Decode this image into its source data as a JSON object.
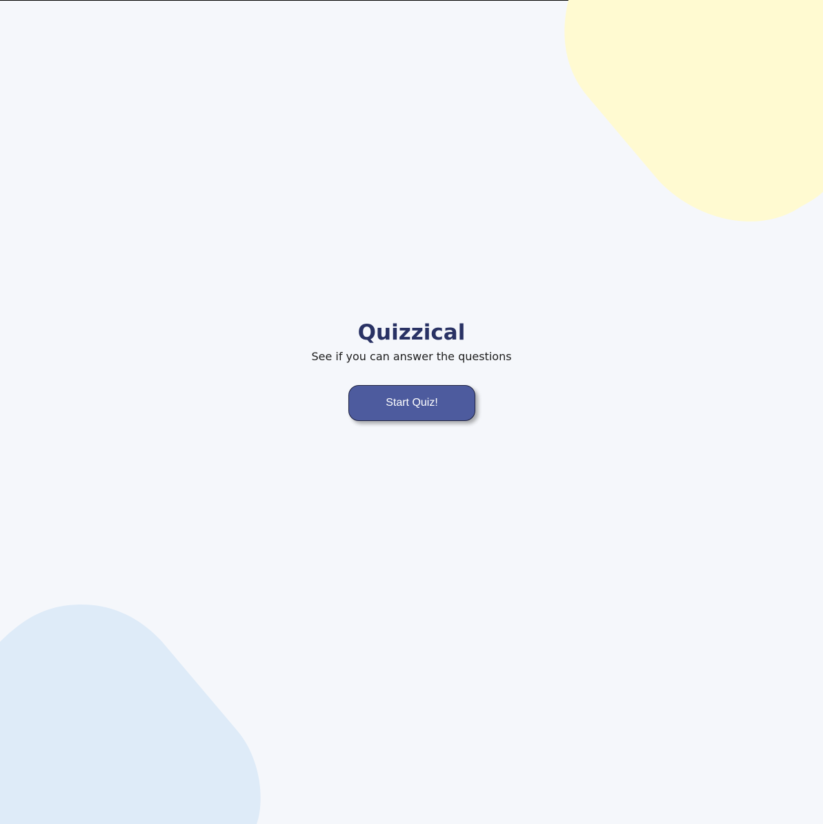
{
  "landing": {
    "title": "Quizzical",
    "subtitle": "See if you can answer the questions",
    "start_button_label": "Start Quiz!"
  },
  "colors": {
    "background": "#F5F7FB",
    "title": "#293264",
    "button": "#4D5B9E",
    "blob_yellow": "#FFFAD1",
    "blob_blue": "#DEEBF8"
  }
}
